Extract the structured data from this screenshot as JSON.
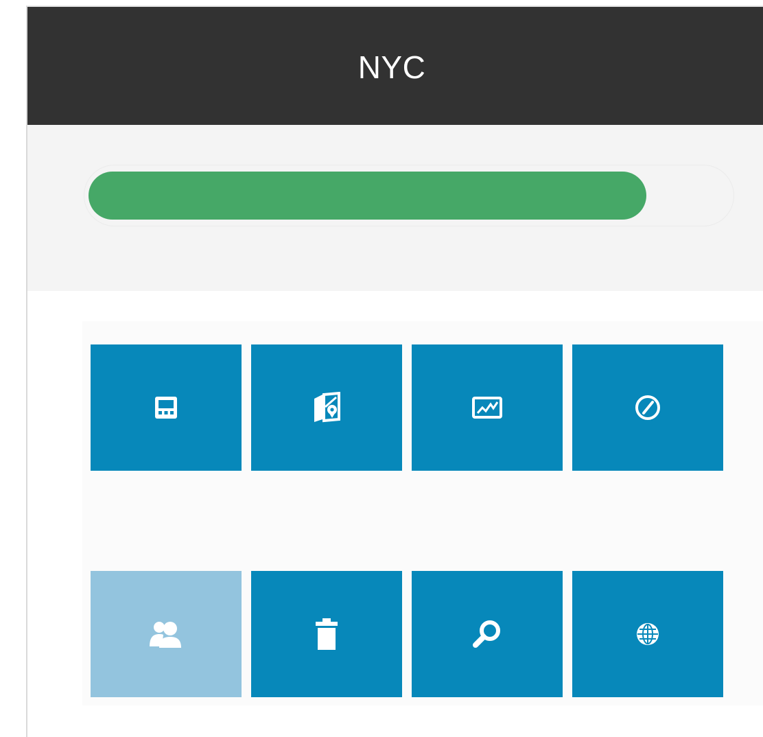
{
  "header": {
    "title": "NYC"
  },
  "progress": {
    "value_percent": 87,
    "fill_color": "#46a867"
  },
  "colors": {
    "tile_active": "#0788ba",
    "tile_muted": "#93c4de",
    "header_bg": "#323232"
  },
  "tiles": [
    {
      "icon": "calculator-icon",
      "state": "active"
    },
    {
      "icon": "map-pin-icon",
      "state": "active"
    },
    {
      "icon": "chart-line-icon",
      "state": "active"
    },
    {
      "icon": "compass-icon",
      "state": "active"
    },
    {
      "icon": "users-icon",
      "state": "muted"
    },
    {
      "icon": "trash-icon",
      "state": "active"
    },
    {
      "icon": "search-icon",
      "state": "active"
    },
    {
      "icon": "globe-icon",
      "state": "active"
    }
  ]
}
